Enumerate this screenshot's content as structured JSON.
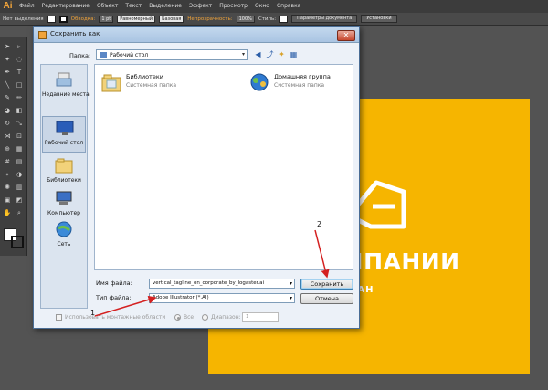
{
  "app": {
    "logo": "Ai",
    "menu": [
      "Файл",
      "Редактирование",
      "Объект",
      "Текст",
      "Выделение",
      "Эффект",
      "Просмотр",
      "Окно",
      "Справка"
    ]
  },
  "control_bar": {
    "selection_label": "Нет выделения",
    "stroke_label": "Обводка:",
    "stroke_weight": "1 pt",
    "profile": "Равномерный",
    "brush": "Базовая",
    "opacity_label": "Непрозрачность:",
    "opacity_value": "100%",
    "style_label": "Стиль:",
    "doc_settings_button": "Параметры документа",
    "prefs_button": "Установки"
  },
  "artboard": {
    "bg_color": "#f6b500",
    "company_text": "КОМПАНИИ",
    "slogan_text": "ГАН"
  },
  "dialog": {
    "title": "Сохранить как",
    "folder_label": "Папка:",
    "folder_value": "Рабочий стол",
    "places": [
      {
        "label": "Недавние места",
        "icon": "recent-places-icon"
      },
      {
        "label": "Рабочий стол",
        "icon": "desktop-icon"
      },
      {
        "label": "Библиотеки",
        "icon": "libraries-icon"
      },
      {
        "label": "Компьютер",
        "icon": "computer-icon"
      },
      {
        "label": "Сеть",
        "icon": "network-icon"
      }
    ],
    "items": [
      {
        "name": "Библиотеки",
        "sub": "Системная папка",
        "icon": "libraries-folder-icon"
      },
      {
        "name": "Домашняя группа",
        "sub": "Системная папка",
        "icon": "homegroup-icon"
      }
    ],
    "filename_label": "Имя файла:",
    "filename_value": "vertical_tagline_on_corporate_by_logaster.ai",
    "filetype_label": "Тип файла:",
    "filetype_value": "Adobe Illustrator (*.AI)",
    "save_button": "Сохранить",
    "cancel_button": "Отмена",
    "use_artboards_label": "Использовать монтажные области",
    "all_label": "Все",
    "range_label": "Диапазон:",
    "range_value": "1"
  },
  "annotations": {
    "marker_1": "1",
    "marker_2": "2",
    "arrow_color": "#d42020"
  }
}
